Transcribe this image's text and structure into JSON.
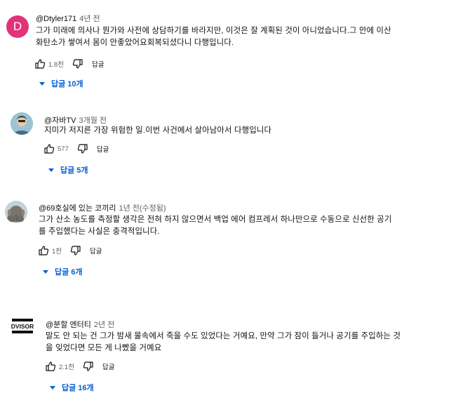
{
  "comments": [
    {
      "avatar_letter": "D",
      "author": "@Dtyler171",
      "time": "4년 전",
      "text_lines": [
        "그가 미래에 의사나 뭔가와 사전에 상담하기를 바라지만, 이것은 잘 계획된 것이 아니었습니다.그 안에 이산",
        "화탄소가 쌓여서 몸이 안좋았어요회복되셨다니 다행입니다."
      ],
      "likes": "1.8천",
      "reply_label": "답글",
      "replies_label": "답글 10개"
    },
    {
      "author": "@자바TV",
      "time": "3개월 전",
      "text_lines": [
        "지미가 저지른 가장 위험한 일.이번 사건에서 살아남아서 다행입니다"
      ],
      "likes": "577",
      "reply_label": "답글",
      "replies_label": "답글 5개"
    },
    {
      "author": "@69호실에 있는 코끼리",
      "time": "1년 전(수정됨)",
      "text_lines": [
        "그가 산소 농도를 측정할 생각은 전혀 하지 않으면서 백업 에어 컴프레서 하나만으로 수동으로 신선한 공기",
        "를 주입했다는 사실은 충격적입니다."
      ],
      "likes": "1천",
      "reply_label": "답글",
      "replies_label": "답글 6개"
    },
    {
      "avatar_text": "DVISOR",
      "author": "@분할 엔터티",
      "time": "2년 전",
      "text_lines": [
        "말도 안 되는 건 그가 밤새 물속에서 죽을 수도 있었다는 거예요, 만약 그가 잠이 들거나 공기를 주입하는 것",
        "을 잊었다면 모든 게 나빴을 거예요"
      ],
      "likes": "2.1천",
      "reply_label": "답글",
      "replies_label": "답글 16개"
    }
  ]
}
